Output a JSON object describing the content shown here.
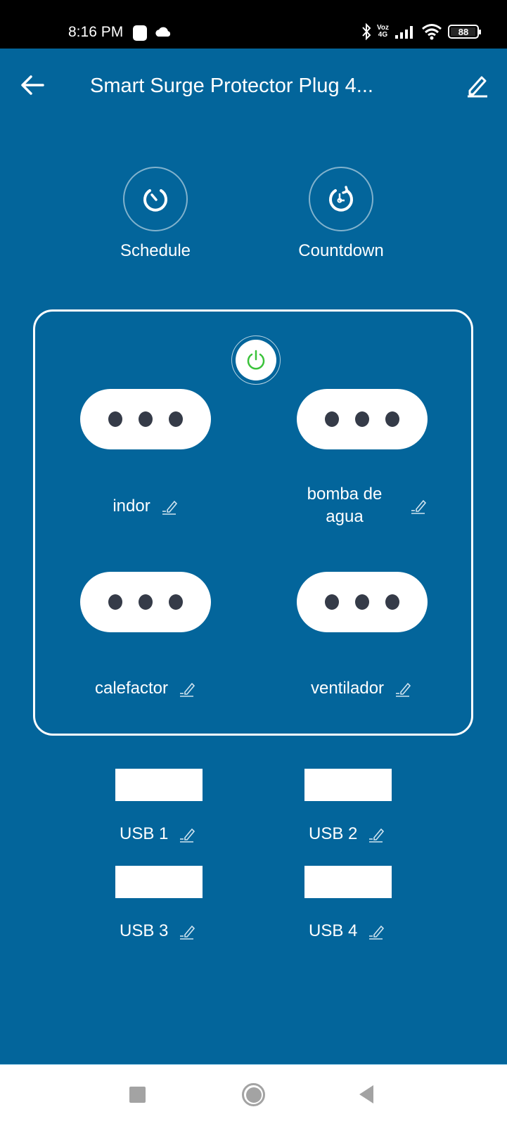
{
  "status_bar": {
    "time": "8:16 PM",
    "network_label_top": "Voz",
    "network_label_bottom": "4G",
    "battery_percent": "88",
    "icons": [
      "notification-square-icon",
      "cloud-icon",
      "bluetooth-icon",
      "signal-icon",
      "wifi-icon",
      "battery-icon"
    ]
  },
  "header": {
    "title": "Smart Surge Protector Plug 4...",
    "back_icon": "arrow-left-icon",
    "edit_icon": "pencil-icon"
  },
  "quick_actions": [
    {
      "label": "Schedule",
      "icon": "timer-icon"
    },
    {
      "label": "Countdown",
      "icon": "countdown-clock-icon"
    }
  ],
  "master_power": {
    "icon": "power-icon",
    "state": "on",
    "color": "#3ac23a"
  },
  "outlets": [
    {
      "label": "indor"
    },
    {
      "label": "bomba de agua"
    },
    {
      "label": "calefactor"
    },
    {
      "label": "ventilador"
    }
  ],
  "usb_ports": [
    {
      "label": "USB 1"
    },
    {
      "label": "USB 2"
    },
    {
      "label": "USB 3"
    },
    {
      "label": "USB 4"
    }
  ],
  "colors": {
    "background": "#03659b",
    "socket_hole": "#353b48",
    "power_on": "#3ac23a"
  },
  "nav_bar": {
    "items": [
      "recent-apps",
      "home",
      "back"
    ]
  }
}
